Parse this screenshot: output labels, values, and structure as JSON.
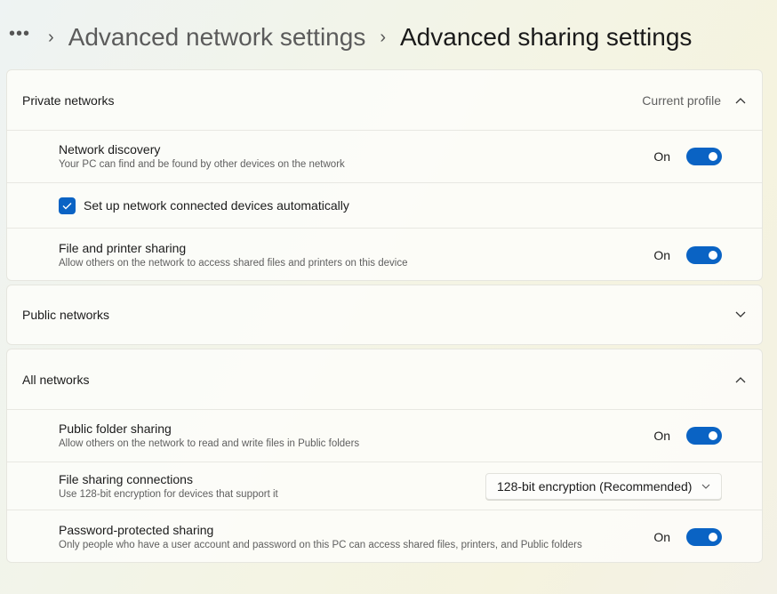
{
  "breadcrumb": {
    "more": "•••",
    "parent": "Advanced network settings",
    "current": "Advanced sharing settings"
  },
  "sections": {
    "private": {
      "title": "Private networks",
      "aside": "Current profile",
      "expanded": true,
      "network_discovery": {
        "title": "Network discovery",
        "description": "Your PC can find and be found by other devices on the network",
        "state_label": "On",
        "on": true
      },
      "auto_setup": {
        "label": "Set up network connected devices automatically",
        "checked": true
      },
      "file_printer_sharing": {
        "title": "File and printer sharing",
        "description": "Allow others on the network to access shared files and printers on this device",
        "state_label": "On",
        "on": true
      }
    },
    "public": {
      "title": "Public networks",
      "expanded": false
    },
    "all": {
      "title": "All networks",
      "expanded": true,
      "public_folder_sharing": {
        "title": "Public folder sharing",
        "description": "Allow others on the network to read and write files in Public folders",
        "state_label": "On",
        "on": true
      },
      "file_sharing_connections": {
        "title": "File sharing connections",
        "description": "Use 128-bit encryption for devices that support it",
        "selected": "128-bit encryption (Recommended)"
      },
      "password_protected_sharing": {
        "title": "Password-protected sharing",
        "description": "Only people who have a user account and password on this PC can access shared files, printers, and Public folders",
        "state_label": "On",
        "on": true
      }
    }
  },
  "colors": {
    "accent": "#0a63c4"
  }
}
